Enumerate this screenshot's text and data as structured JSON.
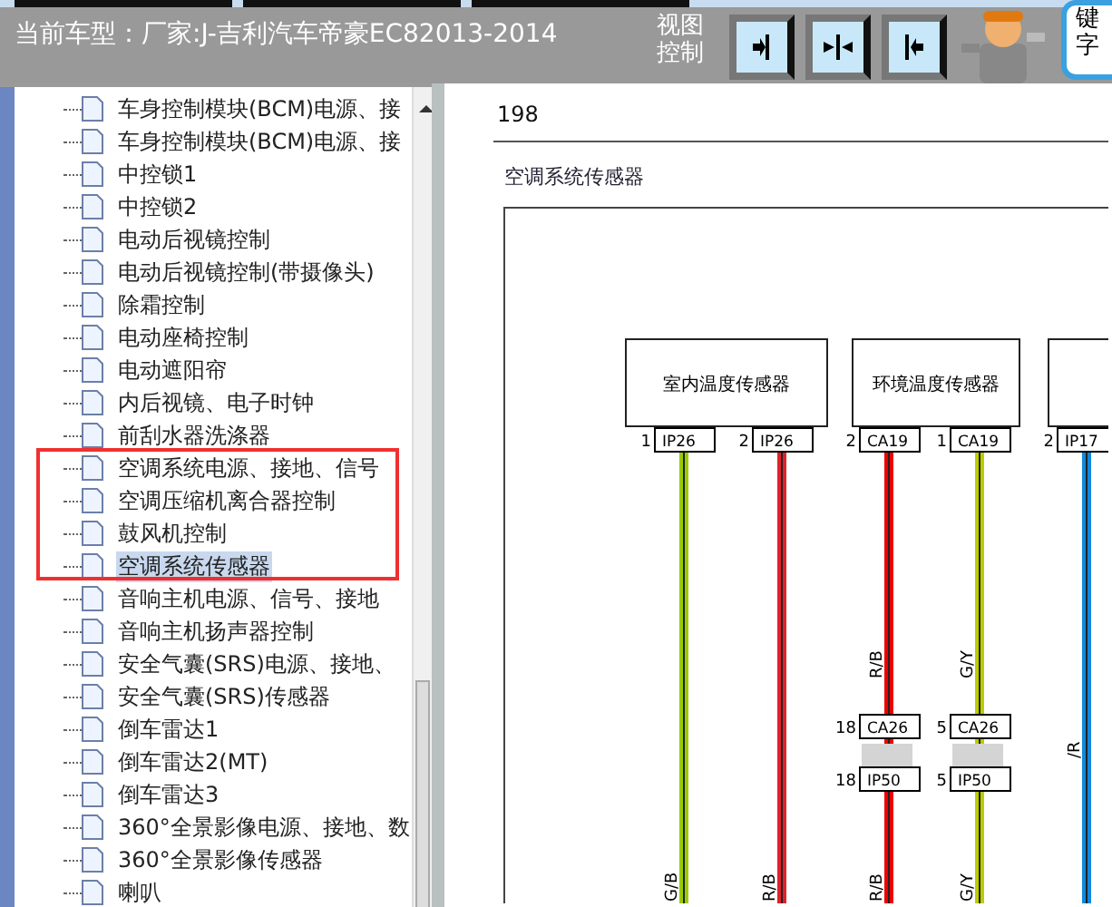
{
  "header": {
    "title": "当前车型：厂家:J-吉利汽车帝豪EC82013-2014",
    "view_label": "视图控制",
    "view_buttons": [
      {
        "kind": "right"
      },
      {
        "kind": "both"
      },
      {
        "kind": "left"
      }
    ],
    "side_chars": [
      "键",
      "字"
    ]
  },
  "tree": {
    "items": [
      {
        "label": "车身控制模块(BCM)电源、接",
        "selected": false
      },
      {
        "label": "车身控制模块(BCM)电源、接",
        "selected": false
      },
      {
        "label": "中控锁1",
        "selected": false
      },
      {
        "label": "中控锁2",
        "selected": false
      },
      {
        "label": "电动后视镜控制",
        "selected": false
      },
      {
        "label": "电动后视镜控制(带摄像头)",
        "selected": false
      },
      {
        "label": "除霜控制",
        "selected": false
      },
      {
        "label": "电动座椅控制",
        "selected": false
      },
      {
        "label": "电动遮阳帘",
        "selected": false
      },
      {
        "label": "内后视镜、电子时钟",
        "selected": false
      },
      {
        "label": "前刮水器洗涤器",
        "selected": false
      },
      {
        "label": "空调系统电源、接地、信号",
        "selected": false
      },
      {
        "label": "空调压缩机离合器控制",
        "selected": false
      },
      {
        "label": "鼓风机控制",
        "selected": false
      },
      {
        "label": "空调系统传感器",
        "selected": true
      },
      {
        "label": "音响主机电源、信号、接地",
        "selected": false
      },
      {
        "label": "音响主机扬声器控制",
        "selected": false
      },
      {
        "label": "安全气囊(SRS)电源、接地、",
        "selected": false
      },
      {
        "label": "安全气囊(SRS)传感器",
        "selected": false
      },
      {
        "label": "倒车雷达1",
        "selected": false
      },
      {
        "label": "倒车雷达2(MT)",
        "selected": false
      },
      {
        "label": "倒车雷达3",
        "selected": false
      },
      {
        "label": "360°全景影像电源、接地、数",
        "selected": false
      },
      {
        "label": "360°全景影像传感器",
        "selected": false
      },
      {
        "label": "喇叭",
        "selected": false
      }
    ]
  },
  "diagram": {
    "page": "198",
    "title": "空调系统传感器",
    "components": [
      {
        "label": "室内温度传感器",
        "pins": [
          {
            "num": "1",
            "code": "IP26"
          },
          {
            "num": "2",
            "code": "IP26"
          }
        ]
      },
      {
        "label": "环境温度传感器",
        "pins": [
          {
            "num": "2",
            "code": "CA19"
          },
          {
            "num": "1",
            "code": "CA19"
          }
        ]
      },
      {
        "pins": [
          {
            "num": "2",
            "code": "IP17"
          }
        ]
      }
    ],
    "wires": [
      {
        "color": "#99cc00",
        "label_bottom": "G/B"
      },
      {
        "color": "#e0222a",
        "label_bottom": "R/B"
      },
      {
        "color": "#ee0000",
        "label_top": "R/B",
        "junction": {
          "top": {
            "num": "18",
            "code": "CA26"
          },
          "bottom": {
            "num": "18",
            "code": "IP50"
          }
        },
        "label_bottom": "R/B"
      },
      {
        "color": "#bbcc00",
        "label_top": "G/Y",
        "junction": {
          "top": {
            "num": "5",
            "code": "CA26"
          },
          "bottom": {
            "num": "5",
            "code": "IP50"
          }
        },
        "label_bottom": "G/Y"
      },
      {
        "color": "#1188dd",
        "label_mid": "/R"
      }
    ]
  }
}
